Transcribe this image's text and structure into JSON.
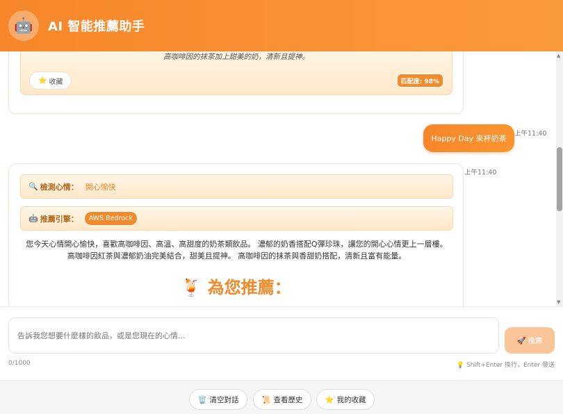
{
  "header": {
    "avatar_icon": "🤖",
    "title": "AI 智能推薦助手"
  },
  "messages": {
    "bot_prev": {
      "rec_description": "高咖啡因的抹茶加上甜美的奶，清新且提神。",
      "favorite_icon": "⭐",
      "favorite_label": "收藏",
      "match_label": "匹配度: 98%"
    },
    "user": {
      "time": "上午11:40",
      "text": "Happy Day 來杯奶茶"
    },
    "bot": {
      "time": "上午11:40",
      "mood_icon": "🔍",
      "mood_label": "檢測心情：",
      "mood_value": "開心愉快",
      "engine_icon": "🤖",
      "engine_label": "推薦引擎：",
      "engine_value": "AWS Bedrock",
      "reason": "您今天心情開心愉快，喜歡高咖啡因、高溫、高甜度的奶茶類飲品。 濃郁的奶香搭配Q彈珍珠，讓您的開心心情更上一層樓。 高咖啡因紅茶與濃郁奶油完美結合，甜美且提神。 高咖啡因的抹茶與香甜奶搭配，清新且富有能量。",
      "rec_heading_icon": "🍹",
      "rec_heading": "為您推薦："
    }
  },
  "input": {
    "placeholder": "告訴我您想要什麼樣的飲品，或是您現在的心情...",
    "send_icon": "🚀",
    "send_label": "推薦",
    "char_count": "0/1000",
    "hint": "💡 Shift+Enter 換行，Enter 發送"
  },
  "footer": {
    "clear_icon": "🗑️",
    "clear_label": "清空對話",
    "history_icon": "📜",
    "history_label": "查看歷史",
    "favorites_icon": "⭐",
    "favorites_label": "我的收藏"
  }
}
